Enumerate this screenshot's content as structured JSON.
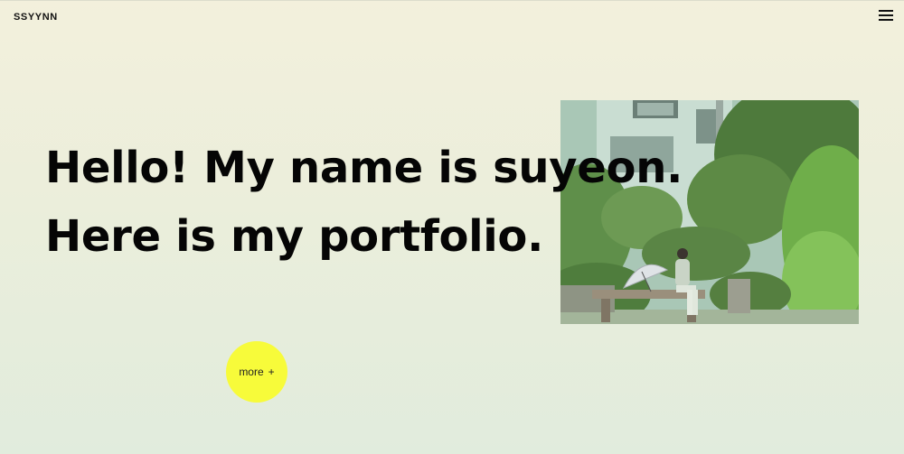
{
  "header": {
    "logo": "SSYYNN",
    "menu_icon": "hamburger-menu-icon"
  },
  "hero": {
    "line1": "Hello! My name is suyeon.",
    "line2": "Here is my portfolio.",
    "more_label": "more",
    "more_icon": "+"
  },
  "photo": {
    "icon": "hero-photo"
  },
  "colors": {
    "accent": "#f7fb3a",
    "background_top": "#f3f0dc",
    "background_bottom": "#e1ecdd",
    "text": "#050505"
  }
}
